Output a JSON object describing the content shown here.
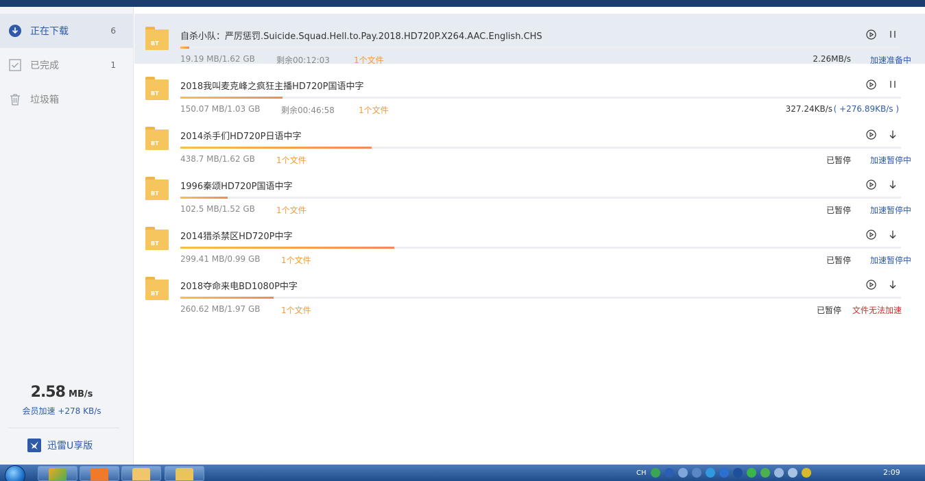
{
  "sidebar": {
    "items": [
      {
        "label": "正在下载",
        "count": "6",
        "icon": "download-circle-icon"
      },
      {
        "label": "已完成",
        "count": "1",
        "icon": "check-box-icon"
      },
      {
        "label": "垃圾箱",
        "count": "",
        "icon": "trash-icon"
      }
    ],
    "speed_value": "2.58",
    "speed_unit": "MB/s",
    "vip_boost": "会员加速 +278 KB/s",
    "brand_label": "迅雷U享版"
  },
  "colors": {
    "accent": "#2e5aa8",
    "file_count": "#f19b36",
    "error": "#d32f2f",
    "progress_start": "#f7c04a",
    "progress_end": "#f08a5d",
    "titlebar": "#1b3e6f"
  },
  "downloads": [
    {
      "name": "自杀小队：严厉惩罚.Suicide.Squad.Hell.to.Pay.2018.HD720P.X264.AAC.English.CHS",
      "size": "19.19 MB/1.62 GB",
      "remaining": "剩余00:12:03",
      "files": "1个文件",
      "progress": 0.012,
      "rate": "2.26MB/s",
      "accel": "加速准备中",
      "accel_status": "normal",
      "state": "downloading",
      "folder_label": "BT"
    },
    {
      "name": "2018我叫麦克峰之疯狂主播HD720P国语中字",
      "size": "150.07 MB/1.03 GB",
      "remaining": "剩余00:46:58",
      "files": "1个文件",
      "progress": 0.142,
      "rate": "327.24KB/s",
      "accel": "( +276.89KB/s )",
      "accel_status": "normal",
      "state": "downloading",
      "folder_label": "BT"
    },
    {
      "name": "2014杀手们HD720P日语中字",
      "size": "438.7 MB/1.62 GB",
      "remaining": "",
      "files": "1个文件",
      "progress": 0.265,
      "rate": "已暂停",
      "accel": "加速暂停中",
      "accel_status": "normal",
      "state": "paused",
      "folder_label": "BT"
    },
    {
      "name": "1996秦颂HD720P国语中字",
      "size": "102.5 MB/1.52 GB",
      "remaining": "",
      "files": "1个文件",
      "progress": 0.066,
      "rate": "已暂停",
      "accel": "加速暂停中",
      "accel_status": "normal",
      "state": "paused",
      "folder_label": "BT"
    },
    {
      "name": "2014猎杀禁区HD720P中字",
      "size": "299.41 MB/0.99 GB",
      "remaining": "",
      "files": "1个文件",
      "progress": 0.297,
      "rate": "已暂停",
      "accel": "加速暂停中",
      "accel_status": "normal",
      "state": "paused",
      "folder_label": "BT"
    },
    {
      "name": "2018夺命来电BD1080P中字",
      "size": "260.62 MB/1.97 GB",
      "remaining": "",
      "files": "1个文件",
      "progress": 0.129,
      "rate": "已暂停",
      "accel": "文件无法加速",
      "accel_status": "error",
      "state": "paused",
      "folder_label": "BT"
    }
  ],
  "taskbar": {
    "lang": "CH",
    "clock": "2:09"
  }
}
